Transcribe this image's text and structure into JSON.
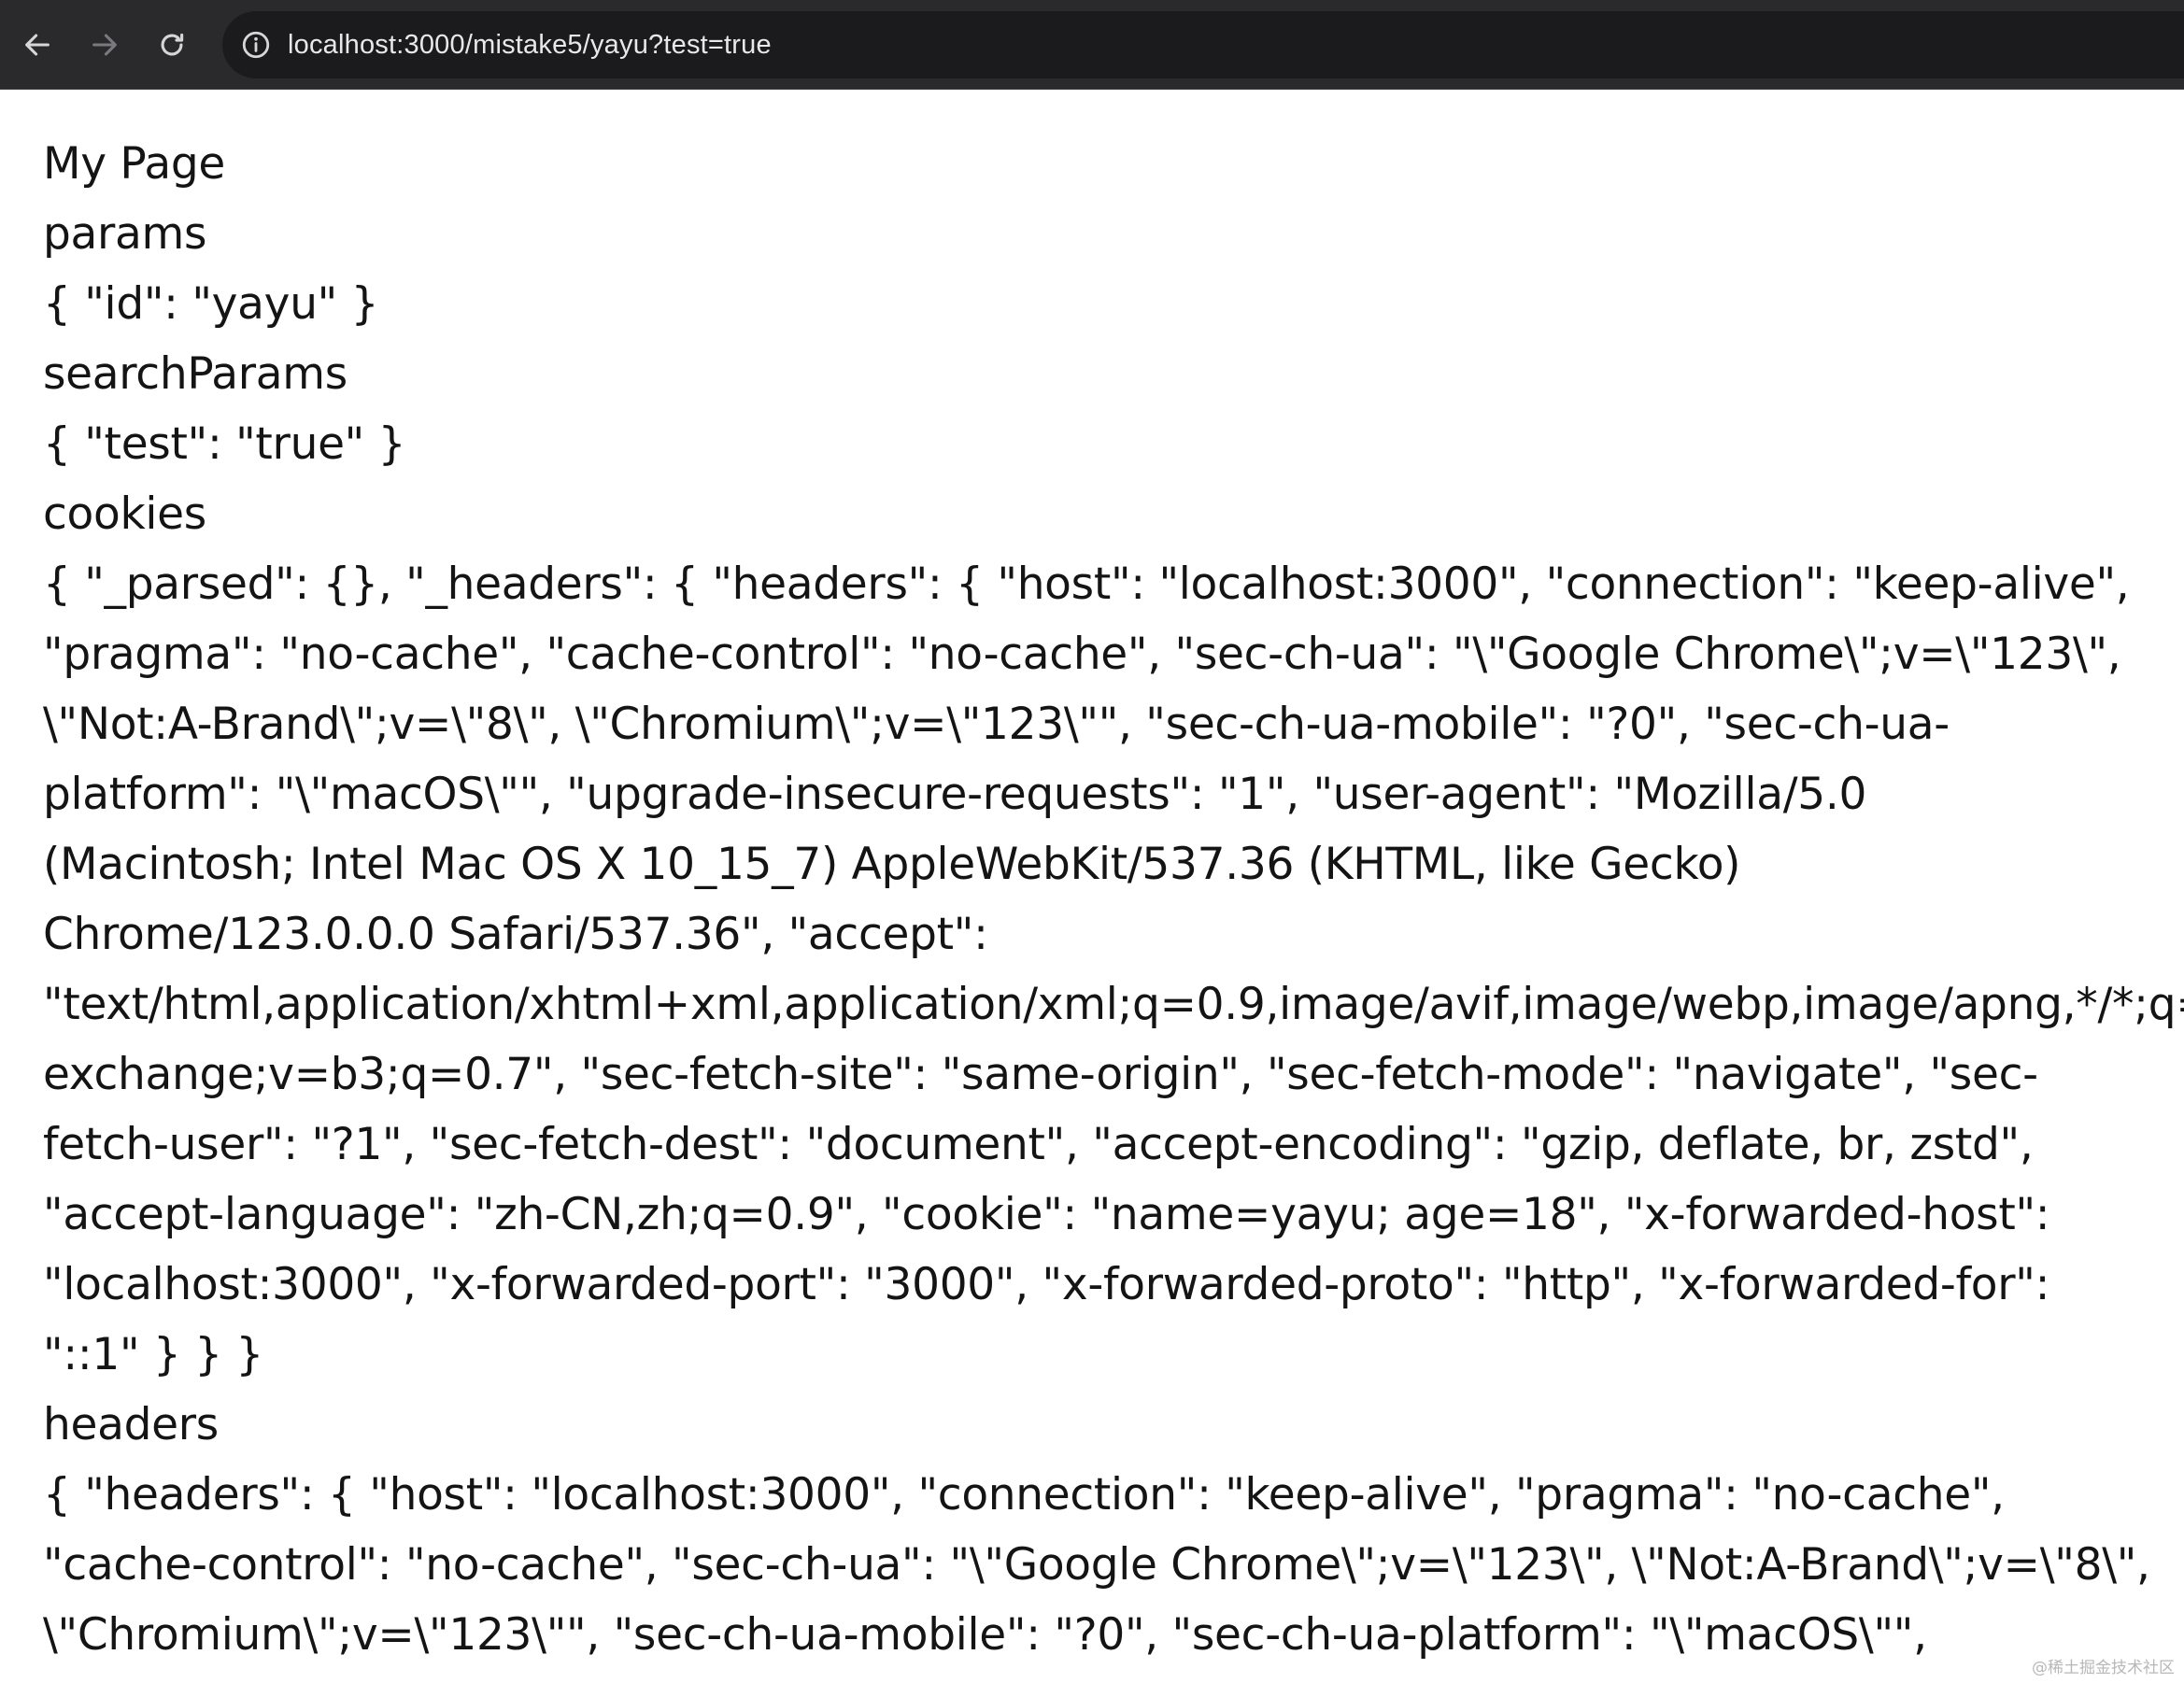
{
  "browser": {
    "url": "localhost:3000/mistake5/yayu?test=true",
    "back_icon": "arrow-left-icon",
    "forward_icon": "arrow-right-icon",
    "reload_icon": "reload-icon",
    "info_icon": "info-icon"
  },
  "page": {
    "lines": [
      "My Page",
      "params",
      "{ \"id\": \"yayu\" }",
      "searchParams",
      "{ \"test\": \"true\" }",
      "cookies",
      "{ \"_parsed\": {}, \"_headers\": { \"headers\": { \"host\": \"localhost:3000\", \"connection\": \"keep-alive\",",
      "\"pragma\": \"no-cache\", \"cache-control\": \"no-cache\", \"sec-ch-ua\": \"\\\"Google Chrome\\\";v=\\\"123\\\",",
      "\\\"Not:A-Brand\\\";v=\\\"8\\\", \\\"Chromium\\\";v=\\\"123\\\"\", \"sec-ch-ua-mobile\": \"?0\", \"sec-ch-ua-",
      "platform\": \"\\\"macOS\\\"\", \"upgrade-insecure-requests\": \"1\", \"user-agent\": \"Mozilla/5.0",
      "(Macintosh; Intel Mac OS X 10_15_7) AppleWebKit/537.36 (KHTML, like Gecko)",
      "Chrome/123.0.0.0 Safari/537.36\", \"accept\":",
      "\"text/html,application/xhtml+xml,application/xml;q=0.9,image/avif,image/webp,image/apng,*/*;q=",
      "exchange;v=b3;q=0.7\", \"sec-fetch-site\": \"same-origin\", \"sec-fetch-mode\": \"navigate\", \"sec-",
      "fetch-user\": \"?1\", \"sec-fetch-dest\": \"document\", \"accept-encoding\": \"gzip, deflate, br, zstd\",",
      "\"accept-language\": \"zh-CN,zh;q=0.9\", \"cookie\": \"name=yayu; age=18\", \"x-forwarded-host\":",
      "\"localhost:3000\", \"x-forwarded-port\": \"3000\", \"x-forwarded-proto\": \"http\", \"x-forwarded-for\":",
      "\"::1\" } } }",
      "headers",
      "{ \"headers\": { \"host\": \"localhost:3000\", \"connection\": \"keep-alive\", \"pragma\": \"no-cache\",",
      "\"cache-control\": \"no-cache\", \"sec-ch-ua\": \"\\\"Google Chrome\\\";v=\\\"123\\\", \\\"Not:A-Brand\\\";v=\\\"8\\\",",
      "\\\"Chromium\\\";v=\\\"123\\\"\", \"sec-ch-ua-mobile\": \"?0\", \"sec-ch-ua-platform\": \"\\\"macOS\\\"\","
    ]
  },
  "watermark": "@稀土掘金技术社区"
}
